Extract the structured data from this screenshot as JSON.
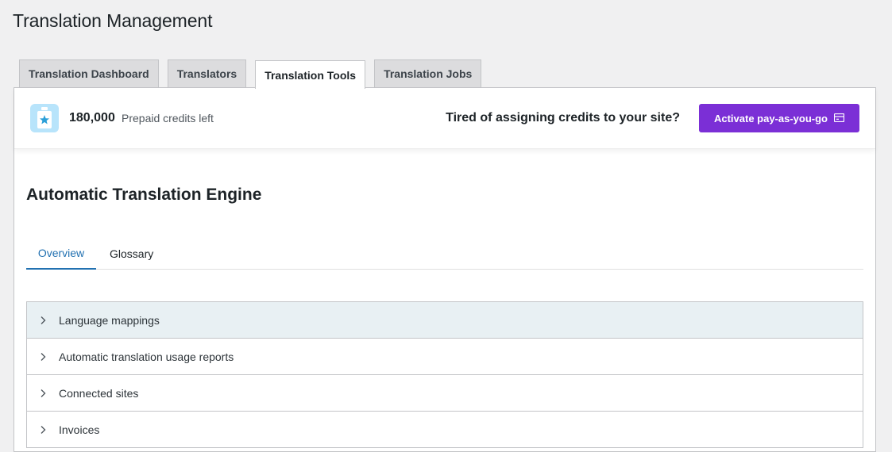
{
  "page": {
    "title": "Translation Management"
  },
  "tabs": [
    {
      "label": "Translation Dashboard"
    },
    {
      "label": "Translators"
    },
    {
      "label": "Translation Tools",
      "active": true
    },
    {
      "label": "Translation Jobs"
    }
  ],
  "credits": {
    "icon": "clipboard-star-icon",
    "count": "180,000",
    "label": "Prepaid credits left"
  },
  "promo": {
    "text": "Tired of assigning credits to your site?",
    "button_label": "Activate pay-as-you-go",
    "button_icon": "card-icon",
    "button_color": "#7b2fd6"
  },
  "engine": {
    "title": "Automatic Translation Engine",
    "subtabs": [
      {
        "label": "Overview",
        "active": true
      },
      {
        "label": "Glossary"
      }
    ],
    "sections": [
      {
        "label": "Language mappings"
      },
      {
        "label": "Automatic translation usage reports"
      },
      {
        "label": "Connected sites"
      },
      {
        "label": "Invoices"
      }
    ]
  },
  "colors": {
    "accent": "#2271b1",
    "purple": "#7b2fd6",
    "icon_bg": "#b8e4fb"
  }
}
